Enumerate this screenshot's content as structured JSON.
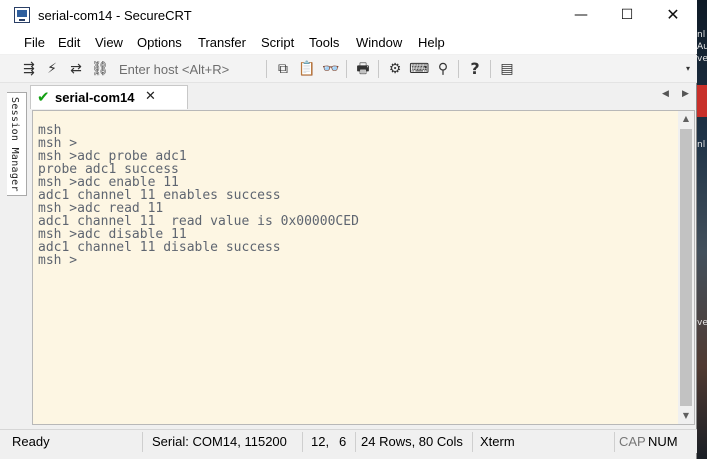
{
  "window": {
    "title": "serial-com14 - SecureCRT",
    "controls": {
      "minimize": "—",
      "maximize": "☐",
      "close": "✕"
    }
  },
  "menu": {
    "items": [
      "File",
      "Edit",
      "View",
      "Options",
      "Transfer",
      "Script",
      "Tools",
      "Window",
      "Help"
    ]
  },
  "toolbar": {
    "host_placeholder": "Enter host <Alt+R>",
    "icons": {
      "connect": "⇶",
      "quick_connect": "⚡",
      "reconnect": "⇄",
      "disconnect": "⛓",
      "copy": "⧉",
      "paste": "📋",
      "find": "👓",
      "print": "🖶",
      "options": "⚙",
      "keymap": "⌨",
      "sftp": "⚲",
      "help": "?",
      "log": "▤"
    },
    "overflow": "▾"
  },
  "side": {
    "session_manager_label": "Session Manager"
  },
  "tabs": {
    "active": {
      "label": "serial-com14",
      "check": "✔",
      "close": "✕"
    },
    "nav_prev": "◀",
    "nav_next": "▶"
  },
  "terminal": {
    "lines": [
      "msh",
      "msh >",
      "msh >adc probe adc1",
      "probe adc1 success",
      "msh >adc enable 11",
      "adc1 channel 11 enables success",
      "msh >adc read 11",
      "adc1 channel 11  read value is 0x00000CED",
      "msh >adc disable 11",
      "adc1 channel 11 disable success",
      "msh >"
    ],
    "scroll_up": "▲",
    "scroll_down": "▼"
  },
  "statusbar": {
    "state": "Ready",
    "connection": "Serial: COM14, 115200",
    "row": "12,",
    "col": "6",
    "size": "24 Rows, 80 Cols",
    "terminal_type": "Xterm",
    "caps": "CAP",
    "num": "NUM"
  },
  "desktop": {
    "fragments": [
      "nl",
      "Au",
      "ve",
      "nl",
      "ve"
    ]
  }
}
